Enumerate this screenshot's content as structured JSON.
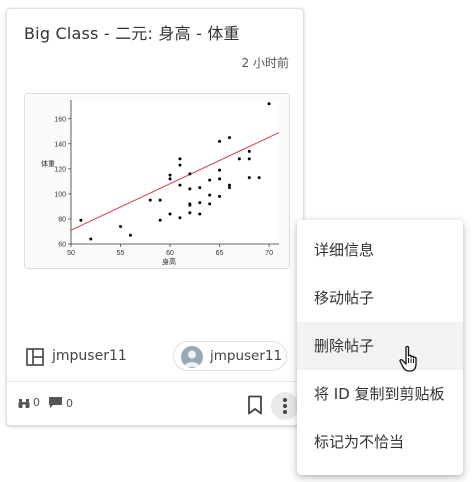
{
  "post": {
    "title": "Big Class - 二元: 身高 - 体重",
    "time": "2 小时前",
    "board": "jmpuser11",
    "author": "jmpuser11",
    "views": "0",
    "comments": "0"
  },
  "icons": {
    "board": "board-layout-icon",
    "avatar": "user-avatar-icon",
    "views": "binoculars-icon",
    "comments": "comment-icon",
    "bookmark": "bookmark-icon",
    "more": "more-vertical-icon",
    "cursor": "hand-pointer-icon"
  },
  "menu": {
    "items": [
      {
        "label": "详细信息"
      },
      {
        "label": "移动帖子"
      },
      {
        "label": "删除帖子"
      },
      {
        "label": "将 ID 复制到剪贴板"
      },
      {
        "label": "标记为不恰当"
      }
    ]
  },
  "chart_data": {
    "type": "scatter",
    "ylabel": "体重",
    "xlabel": "身高",
    "xlim": [
      50,
      71
    ],
    "ylim": [
      60,
      175
    ],
    "xticks": [
      50,
      55,
      60,
      65,
      70
    ],
    "yticks": [
      60,
      80,
      100,
      120,
      140,
      160
    ],
    "colors": {
      "points": "#000000",
      "fit_line": "#d6404c"
    },
    "fit_line": {
      "x": [
        50,
        71
      ],
      "y": [
        71,
        149
      ]
    },
    "points": [
      {
        "x": 51,
        "y": 79
      },
      {
        "x": 52,
        "y": 64
      },
      {
        "x": 55,
        "y": 74
      },
      {
        "x": 56,
        "y": 67
      },
      {
        "x": 58,
        "y": 95
      },
      {
        "x": 59,
        "y": 79
      },
      {
        "x": 59,
        "y": 95
      },
      {
        "x": 60,
        "y": 84
      },
      {
        "x": 60,
        "y": 112
      },
      {
        "x": 60,
        "y": 115
      },
      {
        "x": 61,
        "y": 81
      },
      {
        "x": 61,
        "y": 123
      },
      {
        "x": 61,
        "y": 128
      },
      {
        "x": 61,
        "y": 107
      },
      {
        "x": 62,
        "y": 85
      },
      {
        "x": 62,
        "y": 91
      },
      {
        "x": 62,
        "y": 92
      },
      {
        "x": 62,
        "y": 104
      },
      {
        "x": 62,
        "y": 116
      },
      {
        "x": 63,
        "y": 84
      },
      {
        "x": 63,
        "y": 93
      },
      {
        "x": 63,
        "y": 105
      },
      {
        "x": 64,
        "y": 92
      },
      {
        "x": 64,
        "y": 99
      },
      {
        "x": 64,
        "y": 111
      },
      {
        "x": 65,
        "y": 98
      },
      {
        "x": 65,
        "y": 112
      },
      {
        "x": 65,
        "y": 119
      },
      {
        "x": 65,
        "y": 142
      },
      {
        "x": 66,
        "y": 105
      },
      {
        "x": 66,
        "y": 107
      },
      {
        "x": 66,
        "y": 145
      },
      {
        "x": 67,
        "y": 128
      },
      {
        "x": 68,
        "y": 113
      },
      {
        "x": 68,
        "y": 128
      },
      {
        "x": 68,
        "y": 134
      },
      {
        "x": 69,
        "y": 113
      },
      {
        "x": 70,
        "y": 172
      }
    ]
  }
}
